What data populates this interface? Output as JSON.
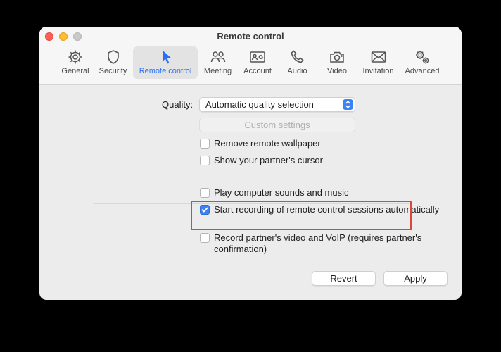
{
  "window": {
    "title": "Remote control"
  },
  "toolbar": {
    "items": [
      {
        "label": "General",
        "icon": "gear-icon"
      },
      {
        "label": "Security",
        "icon": "shield-icon"
      },
      {
        "label": "Remote control",
        "icon": "cursor-icon",
        "selected": true
      },
      {
        "label": "Meeting",
        "icon": "people-icon"
      },
      {
        "label": "Account",
        "icon": "contact-card-icon"
      },
      {
        "label": "Audio",
        "icon": "phone-icon"
      },
      {
        "label": "Video",
        "icon": "camera-icon"
      },
      {
        "label": "Invitation",
        "icon": "envelope-icon"
      },
      {
        "label": "Advanced",
        "icon": "gears-icon"
      }
    ]
  },
  "quality": {
    "label": "Quality:",
    "selected": "Automatic quality selection",
    "custom_settings_label": "Custom settings"
  },
  "options": {
    "remove_wallpaper": {
      "label": "Remove remote wallpaper",
      "checked": false
    },
    "show_cursor": {
      "label": "Show your partner's cursor",
      "checked": false
    },
    "play_sounds": {
      "label": "Play computer sounds and music",
      "checked": false
    },
    "start_recording": {
      "label": "Start recording of remote control sessions automatically",
      "checked": true
    },
    "record_video": {
      "label": "Record partner's video and VoIP (requires partner's confirmation)",
      "checked": false
    }
  },
  "buttons": {
    "revert": "Revert",
    "apply": "Apply"
  },
  "colors": {
    "accent": "#3b82f6",
    "highlight": "#e0453a"
  }
}
